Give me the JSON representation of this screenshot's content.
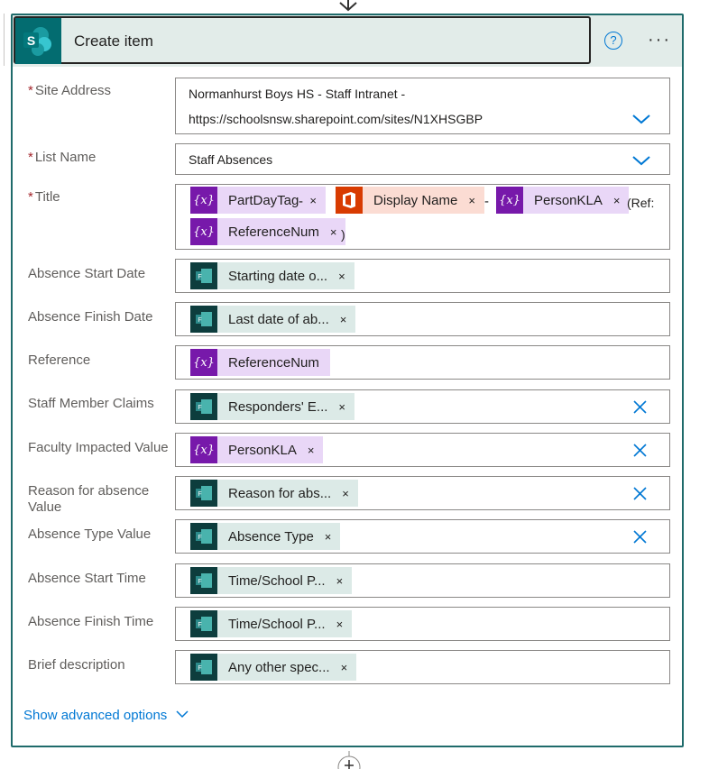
{
  "action": {
    "title": "Create item",
    "logo_icon": "sharepoint-icon",
    "help_icon": "help-icon",
    "more_icon": "more-icon"
  },
  "fields": {
    "site_address": {
      "label": "Site Address",
      "line1": "Normanhurst Boys HS - Staff Intranet -",
      "line2": "https://schoolsnsw.sharepoint.com/sites/N1XHSGBP"
    },
    "list_name": {
      "label": "List Name",
      "value": "Staff Absences"
    },
    "title": {
      "label": "Title",
      "token1": "PartDayTag",
      "sep1": "-",
      "token2": "Display Name",
      "sep2": "-",
      "token3": "PersonKLA",
      "text_ref": "(Ref:",
      "token4": "ReferenceNum",
      "text_end": ")"
    },
    "absence_start_date": {
      "label": "Absence Start Date",
      "token": "Starting date o..."
    },
    "absence_finish_date": {
      "label": "Absence Finish Date",
      "token": "Last date of ab..."
    },
    "reference": {
      "label": "Reference",
      "token": "ReferenceNum"
    },
    "staff_member_claims": {
      "label": "Staff Member Claims",
      "token": "Responders' E..."
    },
    "faculty_impacted": {
      "label": "Faculty Impacted Value",
      "token": "PersonKLA"
    },
    "reason_for_absence": {
      "label": "Reason for absence Value",
      "token": "Reason for abs..."
    },
    "absence_type": {
      "label": "Absence Type Value",
      "token": "Absence Type"
    },
    "absence_start_time": {
      "label": "Absence Start Time",
      "token": "Time/School P..."
    },
    "absence_finish_time": {
      "label": "Absence Finish Time",
      "token": "Time/School P..."
    },
    "brief_description": {
      "label": "Brief description",
      "token": "Any other spec..."
    }
  },
  "required_mark": "*",
  "token_close": "×",
  "show_advanced": "Show advanced options",
  "colors": {
    "accent": "#0078d4",
    "header_bg": "#e2ece9",
    "card_border": "#1f6b6b",
    "variable_token": "#e9d7f7",
    "forms_token": "#dceae7",
    "office_token": "#fbdcd3"
  }
}
